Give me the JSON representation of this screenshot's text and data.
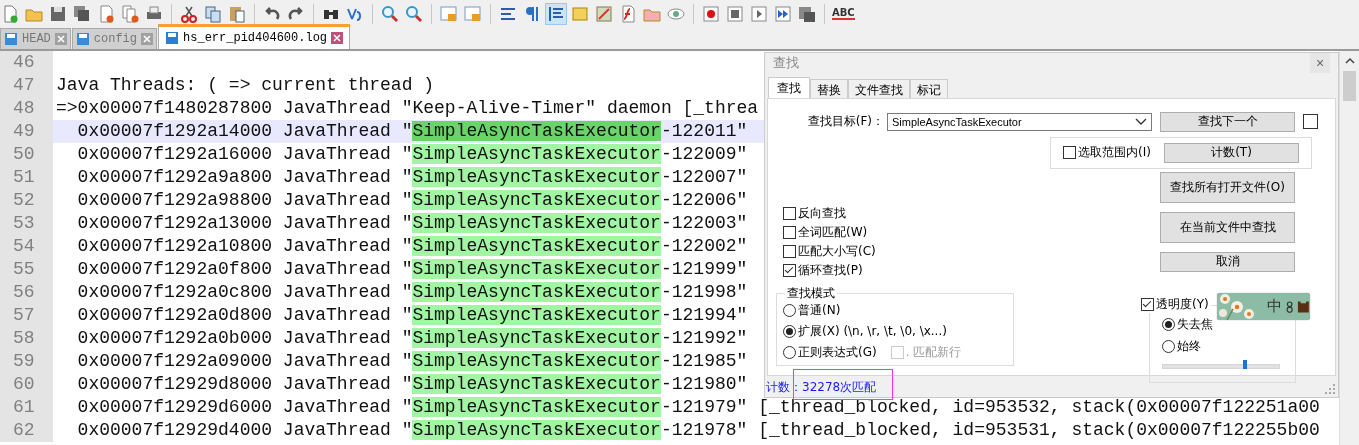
{
  "toolbar": {
    "spellcheck_label": "ABC"
  },
  "tabs": [
    {
      "label": "HEAD",
      "selected": false
    },
    {
      "label": "config",
      "selected": false
    },
    {
      "label": "hs_err_pid404600.log",
      "selected": true
    }
  ],
  "editor": {
    "lines": [
      {
        "number": "46",
        "kind": "blank",
        "current": false
      },
      {
        "number": "47",
        "kind": "plain",
        "current": false,
        "text": "Java Threads: ( => current thread )"
      },
      {
        "number": "48",
        "kind": "plain",
        "current": false,
        "text": "=>0x00007f1480287800 JavaThread \"Keep-Alive-Timer\" daemon [_threa"
      },
      {
        "number": "49",
        "kind": "match",
        "current": true,
        "text": "  0x00007f1292a14000 JavaThread \"",
        "match": "SimpleAsyncTaskExecutor",
        "after": "-122011\""
      },
      {
        "number": "50",
        "kind": "match",
        "current": false,
        "text": "  0x00007f1292a16000 JavaThread \"",
        "match": "SimpleAsyncTaskExecutor",
        "after": "-122009\""
      },
      {
        "number": "51",
        "kind": "match",
        "current": false,
        "text": "  0x00007f1292a9a800 JavaThread \"",
        "match": "SimpleAsyncTaskExecutor",
        "after": "-122007\""
      },
      {
        "number": "52",
        "kind": "match",
        "current": false,
        "text": "  0x00007f1292a98800 JavaThread \"",
        "match": "SimpleAsyncTaskExecutor",
        "after": "-122006\""
      },
      {
        "number": "53",
        "kind": "match",
        "current": false,
        "text": "  0x00007f1292a13000 JavaThread \"",
        "match": "SimpleAsyncTaskExecutor",
        "after": "-122003\""
      },
      {
        "number": "54",
        "kind": "match",
        "current": false,
        "text": "  0x00007f1292a10800 JavaThread \"",
        "match": "SimpleAsyncTaskExecutor",
        "after": "-122002\""
      },
      {
        "number": "55",
        "kind": "match",
        "current": false,
        "text": "  0x00007f1292a0f800 JavaThread \"",
        "match": "SimpleAsyncTaskExecutor",
        "after": "-121999\""
      },
      {
        "number": "56",
        "kind": "match",
        "current": false,
        "text": "  0x00007f1292a0c800 JavaThread \"",
        "match": "SimpleAsyncTaskExecutor",
        "after": "-121998\""
      },
      {
        "number": "57",
        "kind": "match",
        "current": false,
        "text": "  0x00007f1292a0d800 JavaThread \"",
        "match": "SimpleAsyncTaskExecutor",
        "after": "-121994\""
      },
      {
        "number": "58",
        "kind": "match",
        "current": false,
        "text": "  0x00007f1292a0b000 JavaThread \"",
        "match": "SimpleAsyncTaskExecutor",
        "after": "-121992\""
      },
      {
        "number": "59",
        "kind": "match",
        "current": false,
        "text": "  0x00007f1292a09000 JavaThread \"",
        "match": "SimpleAsyncTaskExecutor",
        "after": "-121985\""
      },
      {
        "number": "60",
        "kind": "match",
        "current": false,
        "text": "  0x00007f12929d8000 JavaThread \"",
        "match": "SimpleAsyncTaskExecutor",
        "after": "-121980\""
      },
      {
        "number": "61",
        "kind": "match",
        "current": false,
        "text": "  0x00007f12929d6000 JavaThread \"",
        "match": "SimpleAsyncTaskExecutor",
        "after": "-121979\" [_thread_blocked, id=953532, stack(0x00007f122251a00"
      },
      {
        "number": "62",
        "kind": "match",
        "current": false,
        "text": "  0x00007f12929d4000 JavaThread \"",
        "match": "SimpleAsyncTaskExecutor",
        "after": "-121978\" [_thread_blocked, id=953531, stack(0x00007f122255b00"
      }
    ]
  },
  "find_dialog": {
    "title": "查找",
    "close": "×",
    "tabs": [
      {
        "label": "查找",
        "selected": true
      },
      {
        "label": "替换",
        "selected": false
      },
      {
        "label": "文件查找",
        "selected": false
      },
      {
        "label": "标记",
        "selected": false
      }
    ],
    "target_label": "查找目标(F)：",
    "target_value": "SimpleAsyncTaskExecutor",
    "find_next": "查找下一个",
    "find_next_checked": false,
    "in_selection": {
      "label": "选取范围内(I)",
      "checked": false
    },
    "count_button": "计数(T)",
    "buttons": [
      "查找所有打开文件(O)",
      "在当前文件中查找",
      "取消"
    ],
    "options": [
      {
        "label": "反向查找",
        "checked": false
      },
      {
        "label": "全词匹配(W)",
        "checked": false
      },
      {
        "label": "匹配大小写(C)",
        "checked": false
      },
      {
        "label": "循环查找(P)",
        "checked": true
      }
    ],
    "mode": {
      "title": "查找模式",
      "options": [
        {
          "label": "普通(N)",
          "selected": false
        },
        {
          "label": "扩展(X) (\\n, \\r, \\t, \\0, \\x...)",
          "selected": true
        },
        {
          "label": "正则表达式(G)",
          "selected": false
        }
      ],
      "dot_newline": {
        "label": ". 匹配新行",
        "checked": false,
        "disabled": true
      }
    },
    "transparency": {
      "label": "透明度(Y)",
      "checked": true,
      "options": [
        {
          "label": "失去焦",
          "selected": true
        },
        {
          "label": "始终",
          "selected": false
        }
      ],
      "level": 0.7
    },
    "status": "计数：32278次匹配"
  },
  "ime_bar": {
    "label": "中"
  }
}
